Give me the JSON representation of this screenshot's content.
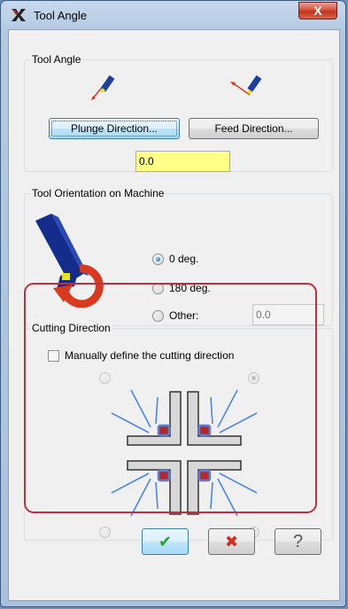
{
  "window": {
    "title": "Tool Angle",
    "close_label": "X"
  },
  "tool_angle": {
    "group_label": "Tool Angle",
    "plunge_button": "Plunge Direction...",
    "feed_button": "Feed Direction...",
    "angle_value": "0.0"
  },
  "orientation": {
    "group_label": "Tool Orientation on Machine",
    "options": [
      {
        "label": "0 deg.",
        "checked": true
      },
      {
        "label": "180 deg.",
        "checked": false
      },
      {
        "label": "Other:",
        "checked": false
      }
    ],
    "other_value": "0.0"
  },
  "cutting": {
    "group_label": "Cutting Direction",
    "manual_label": "Manually define the cutting direction",
    "manual_checked": false
  },
  "buttons": {
    "ok_glyph": "✔",
    "cancel_glyph": "✖",
    "help_glyph": "?"
  },
  "colors": {
    "highlight": "#b8323f",
    "tool_blue": "#1f3f9a",
    "tip_yellow": "#e8e21a",
    "arrow_red": "#d93a1e",
    "input_yellow": "#ffff88"
  }
}
